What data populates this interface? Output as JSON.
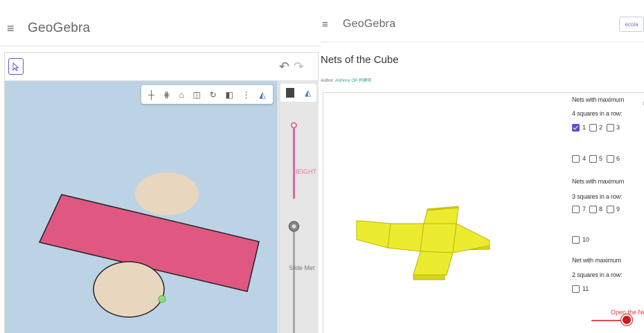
{
  "left_window": {
    "header": {
      "menu_icon": "hamburger-menu-icon",
      "brand": "GeoGebra"
    },
    "toolbar": {
      "move_tool_icon": "move-cursor-icon",
      "undo_icon": "undo-icon",
      "redo_icon": "redo-icon"
    },
    "style_bar": {
      "icons": [
        "axes-icon",
        "grid-icon",
        "home-icon",
        "view-cube-icon",
        "rotate-view-icon",
        "clipping-icon",
        "more-icon",
        "style-toggle-icon"
      ]
    },
    "side_panel": {
      "tabs": [
        "graphics-tab-icon",
        "3d-view-tab-icon"
      ],
      "slider_height_label": "HEIGHT",
      "slider_slide_label": "Slide Met"
    },
    "colors": {
      "canvas": "#bcd3e6",
      "rectangle": "#e05882",
      "ellipse": "#e8d6bf",
      "accent": "#6557d2"
    }
  },
  "right_window": {
    "header": {
      "menu_icon": "hamburger-menu-icon",
      "brand": "GeoGebra",
      "button_label": "ecola"
    },
    "title": "Nets of the Cube",
    "author_prefix": "Author:",
    "author_name": "Anthony OR 柯建明",
    "controls": {
      "group1_line1": "Nets with maximum",
      "group1_line2": "4 squares in a row:",
      "group2_line1": "Nets with maximum",
      "group2_line2": "3 squares in a row:",
      "group3_line1": "Net with maximum",
      "group3_line2": "2 squares in a row:",
      "checkboxes": [
        {
          "label": "1",
          "checked": true
        },
        {
          "label": "2",
          "checked": false
        },
        {
          "label": "3",
          "checked": false
        },
        {
          "label": "4",
          "checked": false
        },
        {
          "label": "5",
          "checked": false
        },
        {
          "label": "6",
          "checked": false
        },
        {
          "label": "7",
          "checked": false
        },
        {
          "label": "8",
          "checked": false
        },
        {
          "label": "9",
          "checked": false
        },
        {
          "label": "10",
          "checked": false
        },
        {
          "label": "11",
          "checked": false
        }
      ],
      "reset_icon": "reset-icon",
      "open_net_label": "Open the Net"
    },
    "colors": {
      "net_fill": "#ecec2e",
      "net_edge": "#c9c200",
      "checkbox_checked": "#5b4fcf",
      "slider": "#e23b3b"
    }
  }
}
